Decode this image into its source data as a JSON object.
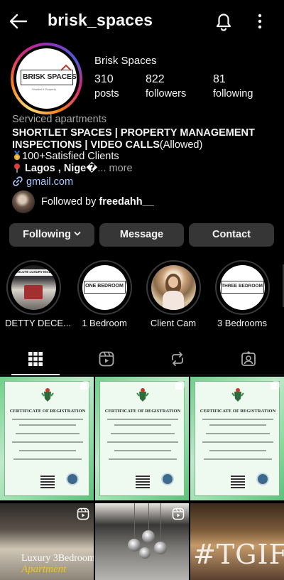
{
  "header": {
    "handle": "brisk_spaces"
  },
  "profile": {
    "avatar_logo_text": "BRISK SPACES",
    "avatar_logo_subtext": "Shortlet & Property",
    "display_name": "Brisk Spaces",
    "stats": [
      {
        "value": "310",
        "label": "posts"
      },
      {
        "value": "822",
        "label": "followers"
      },
      {
        "value": "81",
        "label": "following"
      }
    ],
    "category": "Serviced apartments",
    "bio_line1": "SHORTLET SPACES | PROPERTY MANAGEMENT",
    "bio_line2_bold": "INSPECTIONS | VIDEO CALLS",
    "bio_line2_normal": "(Allowed)",
    "bio_line3": "100+Satisfied Clients",
    "bio_line4_bold": "Lagos , Nige�",
    "bio_line4_more": "... more",
    "link": "gmail.com",
    "followed_by_prefix": "Followed by ",
    "followed_by_name": "freedahh__"
  },
  "actions": {
    "following_label": "Following",
    "message_label": "Message",
    "contact_label": "Contact"
  },
  "highlights": [
    {
      "label": "DETTY DECE...",
      "thumb_text": "ABSOLUTE LUXURY INCLUDES"
    },
    {
      "label": "1 Bedroom",
      "thumb_text": "ONE BEDROOM"
    },
    {
      "label": "Client Cam",
      "thumb_text": ""
    },
    {
      "label": "3 Bedrooms",
      "thumb_text": "THREE BEDROOM"
    }
  ],
  "tabs": [
    {
      "icon": "grid-icon"
    },
    {
      "icon": "reels-icon"
    },
    {
      "icon": "reposts-icon"
    },
    {
      "icon": "tagged-icon"
    }
  ],
  "grid": {
    "cert_title": "CERTIFICATE OF REGISTRATION",
    "photos": [
      {
        "line1": "Luxury 3Bedroom",
        "line2": "Apartment"
      },
      {
        "line1": ""
      },
      {
        "line1": "#TGIF"
      }
    ]
  },
  "colors": {
    "background": "#000000",
    "button_bg": "#363636",
    "secondary_text": "#a8a8a8",
    "link_text": "#a9c8ff"
  }
}
